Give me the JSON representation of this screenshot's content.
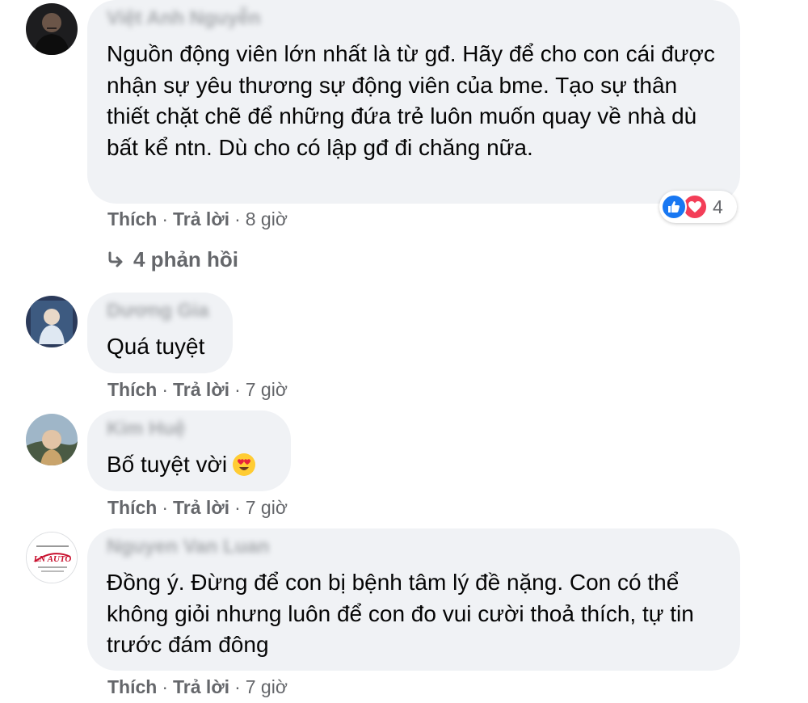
{
  "comments": [
    {
      "author": "Việt Anh Nguyễn",
      "text": "Nguồn động viên lớn nhất là từ gđ. Hãy để cho con cái được nhận sự yêu thương sự động viên của bme. Tạo sự thân thiết chặt chẽ để những đứa trẻ luôn muốn quay về nhà dù bất kể ntn. Dù cho có lập gđ đi chăng nữa.",
      "like": "Thích",
      "reply": "Trả lời",
      "time": "8 giờ",
      "reaction_count": "4"
    },
    {
      "author": "Dương Gia",
      "text": "Quá tuyệt",
      "like": "Thích",
      "reply": "Trả lời",
      "time": "7 giờ"
    },
    {
      "author": "Kim Huệ",
      "text": "Bố tuyệt vời",
      "like": "Thích",
      "reply": "Trả lời",
      "time": "7 giờ"
    },
    {
      "author": "Nguyen Van Luan",
      "text": "Đồng ý. Đừng để con bị bệnh tâm lý đề nặng. Con có thể không giỏi nhưng luôn để con đo vui cười thoả thích, tự tin trước đám đông",
      "like": "Thích",
      "reply": "Trả lời",
      "time": "7 giờ"
    }
  ],
  "replies_link": "4 phản hồi",
  "separator": "·",
  "logo_text": "LN AUTO",
  "colors": {
    "bubble": "#f0f2f5",
    "meta_text": "#65676b",
    "like_blue": "#1877f2",
    "love_red": "#f33e58"
  }
}
